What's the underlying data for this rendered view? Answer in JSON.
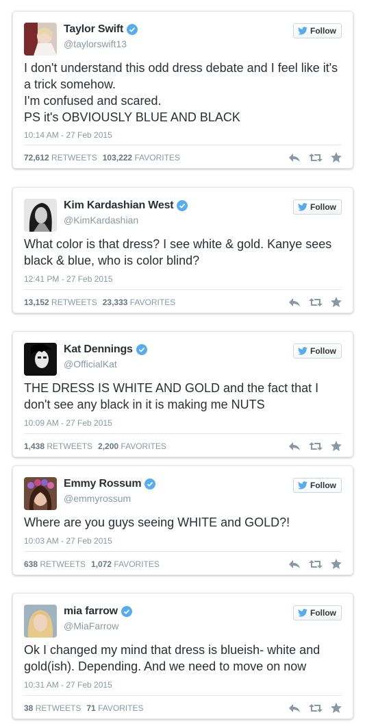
{
  "follow_label": "Follow",
  "retweets_label": "RETWEETS",
  "favorites_label": "FAVORITES",
  "tweets": [
    {
      "name": "Taylor Swift",
      "handle": "@taylorswift13",
      "text": "I don't understand this odd dress debate and I feel like it's a trick somehow.\nI'm confused and scared.\nPS it's OBVIOUSLY BLUE AND BLACK",
      "time": "10:14 AM - 27 Feb 2015",
      "retweets": "72,612",
      "favorites": "103,222"
    },
    {
      "name": "Kim Kardashian West",
      "handle": "@KimKardashian",
      "text": "What color is that dress? I see white & gold. Kanye sees black & blue, who is color blind?",
      "time": "12:41 PM - 27 Feb 2015",
      "retweets": "13,152",
      "favorites": "23,333"
    },
    {
      "name": "Kat Dennings",
      "handle": "@OfficialKat",
      "text": "THE DRESS IS WHITE AND GOLD and the fact that I don't see any black in it is making me NUTS",
      "time": "10:09 AM - 27 Feb 2015",
      "retweets": "1,438",
      "favorites": "2,200"
    },
    {
      "name": "Emmy Rossum",
      "handle": "@emmyrossum",
      "text": "Where are you guys seeing WHITE and GOLD?!",
      "time": "10:03 AM - 27 Feb 2015",
      "retweets": "638",
      "favorites": "1,072"
    },
    {
      "name": "mia farrow",
      "handle": "@MiaFarrow",
      "text": "Ok I changed my mind that dress is blueish- white and gold(ish).  Depending.  And we need to move on now",
      "time": "10:31 AM - 27 Feb 2015",
      "retweets": "38",
      "favorites": "71"
    }
  ],
  "colors": {
    "verified": "#55acee",
    "name": "#292f33",
    "meta": "#8899a6",
    "icon": "#8899a6"
  },
  "icons": [
    "verified-badge-icon",
    "twitter-bird-icon",
    "reply-icon",
    "retweet-icon",
    "favorite-star-icon"
  ]
}
